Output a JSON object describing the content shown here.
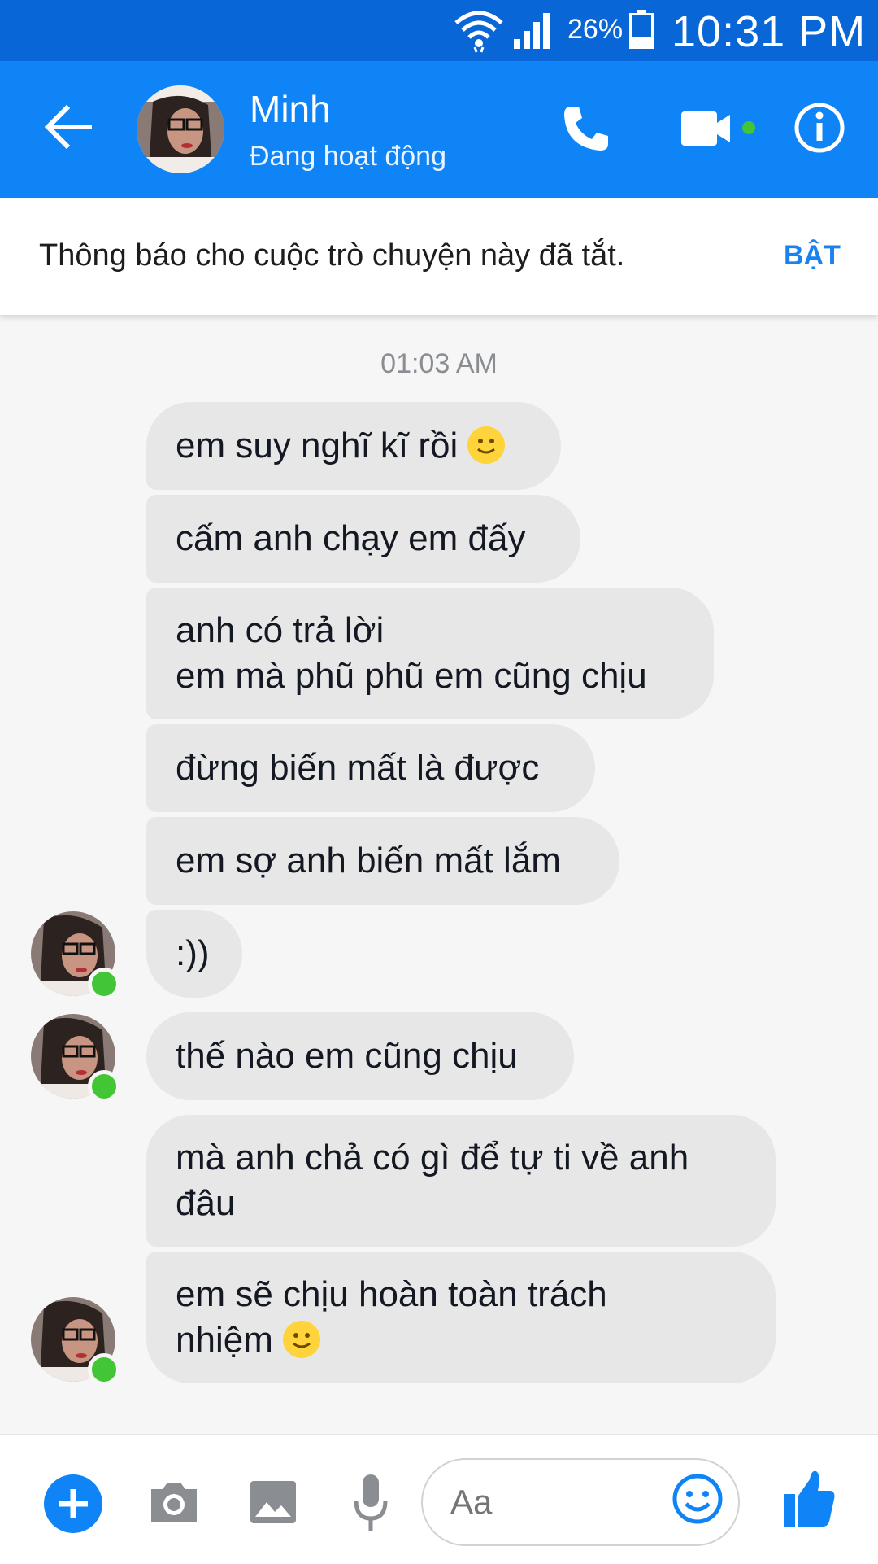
{
  "status_bar": {
    "battery": "26%",
    "time": "10:31 PM",
    "icons": [
      "wifi-icon",
      "signal-icon",
      "battery-icon"
    ]
  },
  "header": {
    "name": "Minh",
    "status": "Đang hoạt động",
    "icons": [
      "back-arrow-icon",
      "phone-icon",
      "video-camera-icon",
      "info-icon"
    ]
  },
  "notice": {
    "text": "Thông báo cho cuộc trò chuyện này đã tắt.",
    "button": "BẬT"
  },
  "timestamp": "01:03 AM",
  "messages": [
    {
      "lines": [
        "em suy nghĩ kĩ rồi"
      ],
      "emoji": "smiling-face-icon"
    },
    {
      "lines": [
        "cấm anh chạy em đấy"
      ]
    },
    {
      "lines": [
        "anh có trả lời",
        "em mà phũ phũ em cũng chịu"
      ]
    },
    {
      "lines": [
        "đừng biến mất là được"
      ]
    },
    {
      "lines": [
        "em sợ anh biến mất lắm"
      ]
    },
    {
      "lines": [
        ":))"
      ]
    },
    {
      "lines": [
        "thế nào em cũng chịu"
      ]
    },
    {
      "lines": [
        "mà anh chả có gì để tự ti về anh",
        "đâu"
      ]
    },
    {
      "lines": [
        "em sẽ chịu hoàn toàn trách",
        "nhiệm"
      ],
      "emoji": "smiling-face-icon"
    }
  ],
  "composer": {
    "placeholder": "Aa",
    "icons": [
      "plus-icon",
      "camera-icon",
      "image-icon",
      "microphone-icon",
      "emoji-icon",
      "thumbs-up-icon"
    ]
  },
  "colors": {
    "status_bar": "#0866d6",
    "header": "#0e84f6",
    "accent": "#1a82f0",
    "bubble": "#e7e7e7",
    "online": "#42c635",
    "emoji": "#ffd33a"
  }
}
